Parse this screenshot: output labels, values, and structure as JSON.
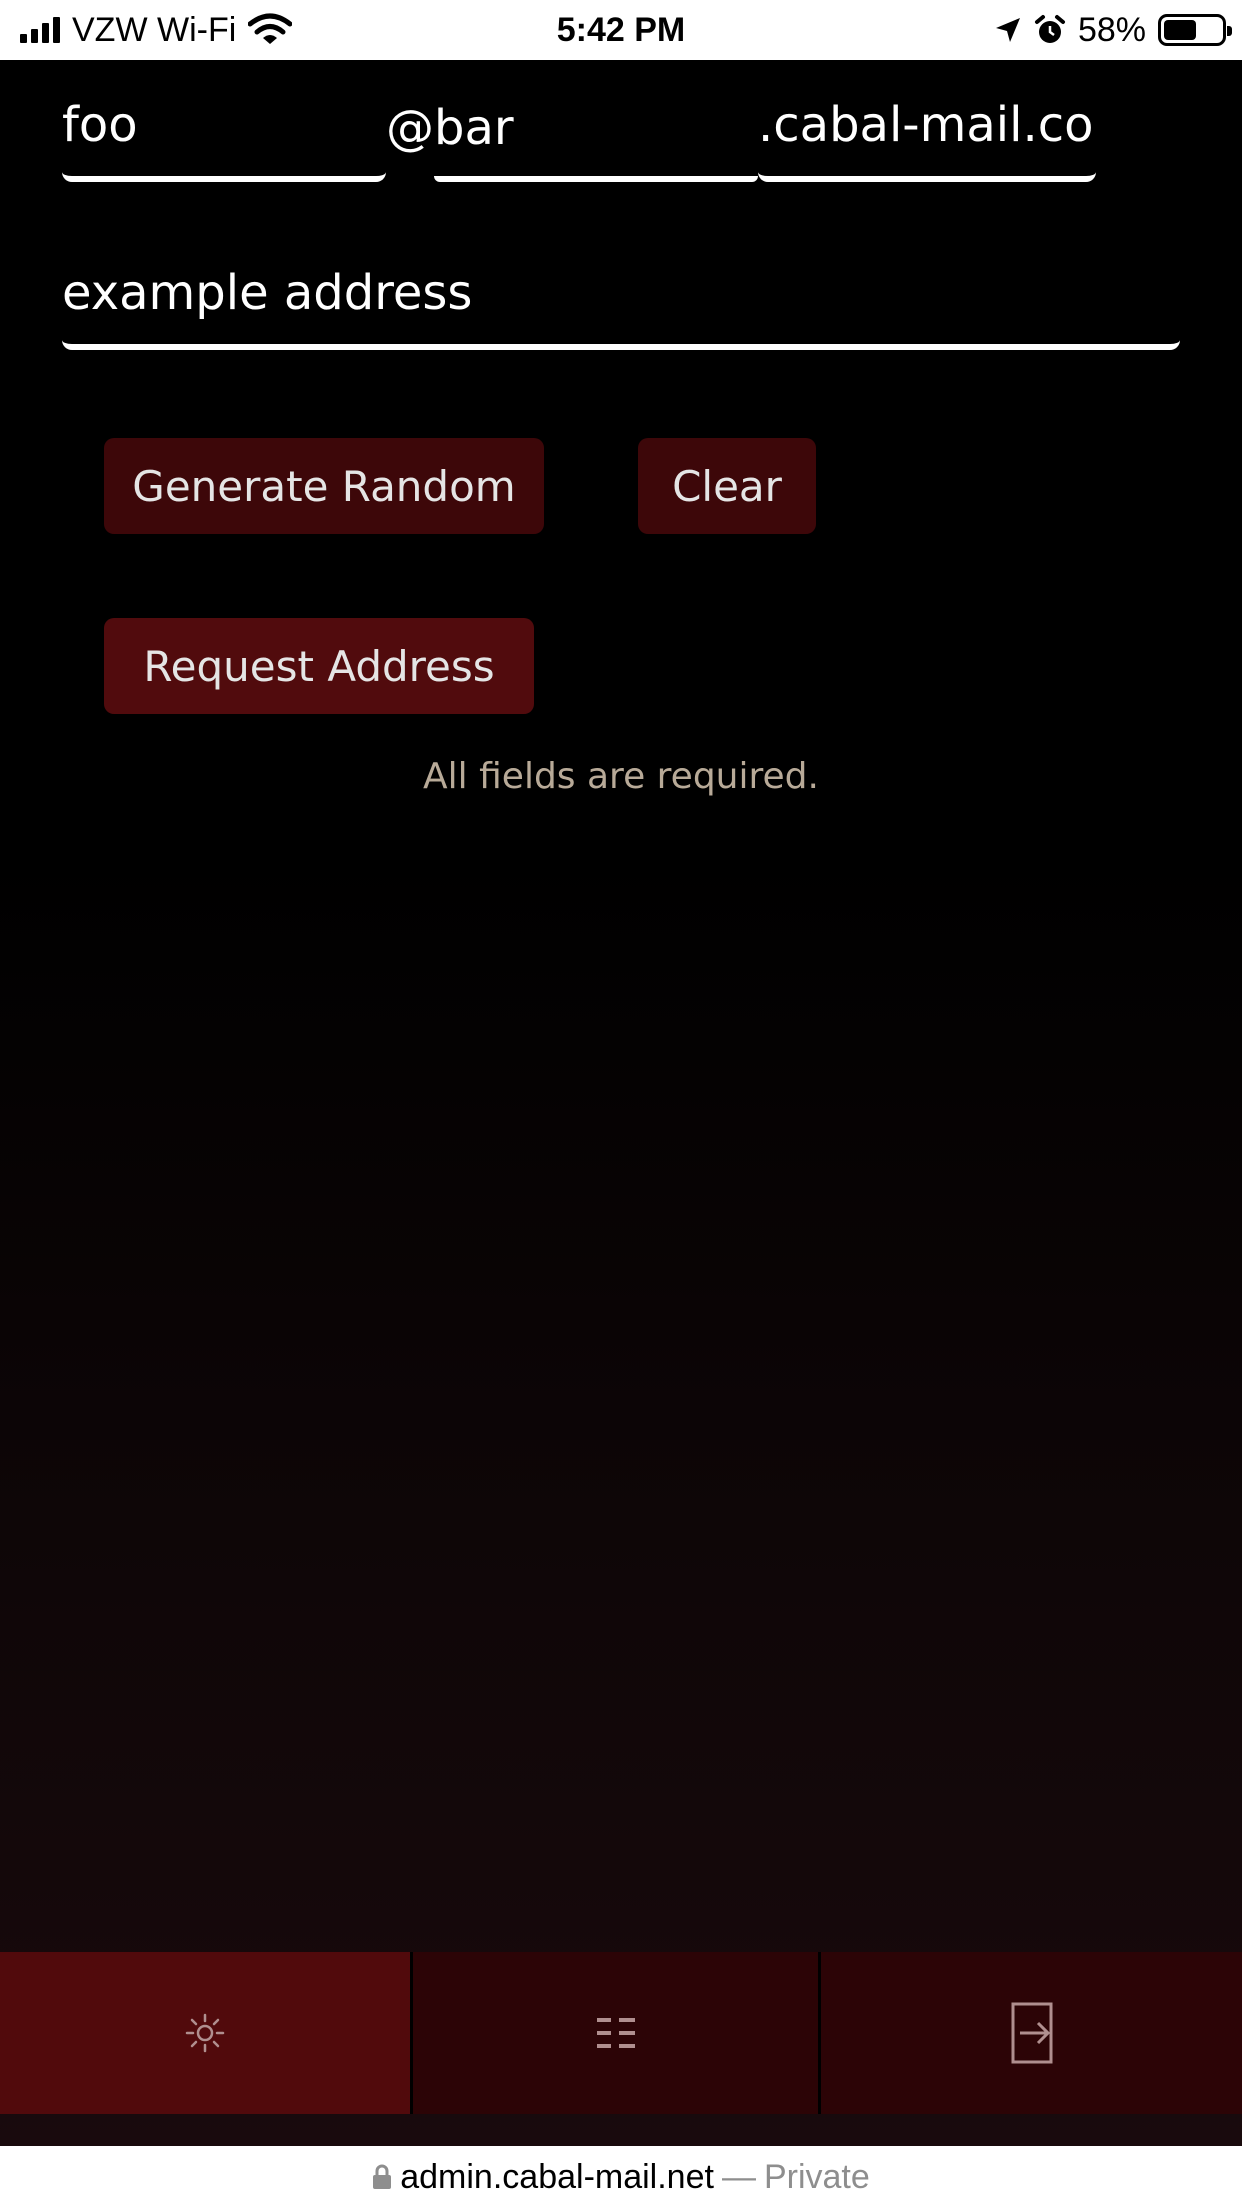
{
  "status_bar": {
    "carrier": "VZW Wi-Fi",
    "time": "5:42 PM",
    "battery": "58%",
    "battery_level": 0.58
  },
  "form": {
    "username": "foo",
    "subdomain": "@bar",
    "domain": ".cabal-mail.com",
    "comment": "example address"
  },
  "buttons": {
    "generate_random": "Generate Random",
    "clear": "Clear",
    "request_address": "Request Address"
  },
  "hint": "All fields are required.",
  "tabs": [
    {
      "icon": "sun-icon"
    },
    {
      "icon": "list-icon"
    },
    {
      "icon": "sign-out-icon"
    }
  ],
  "url_bar": {
    "domain": "admin.cabal-mail.net",
    "separator": "—",
    "mode": "Private"
  }
}
